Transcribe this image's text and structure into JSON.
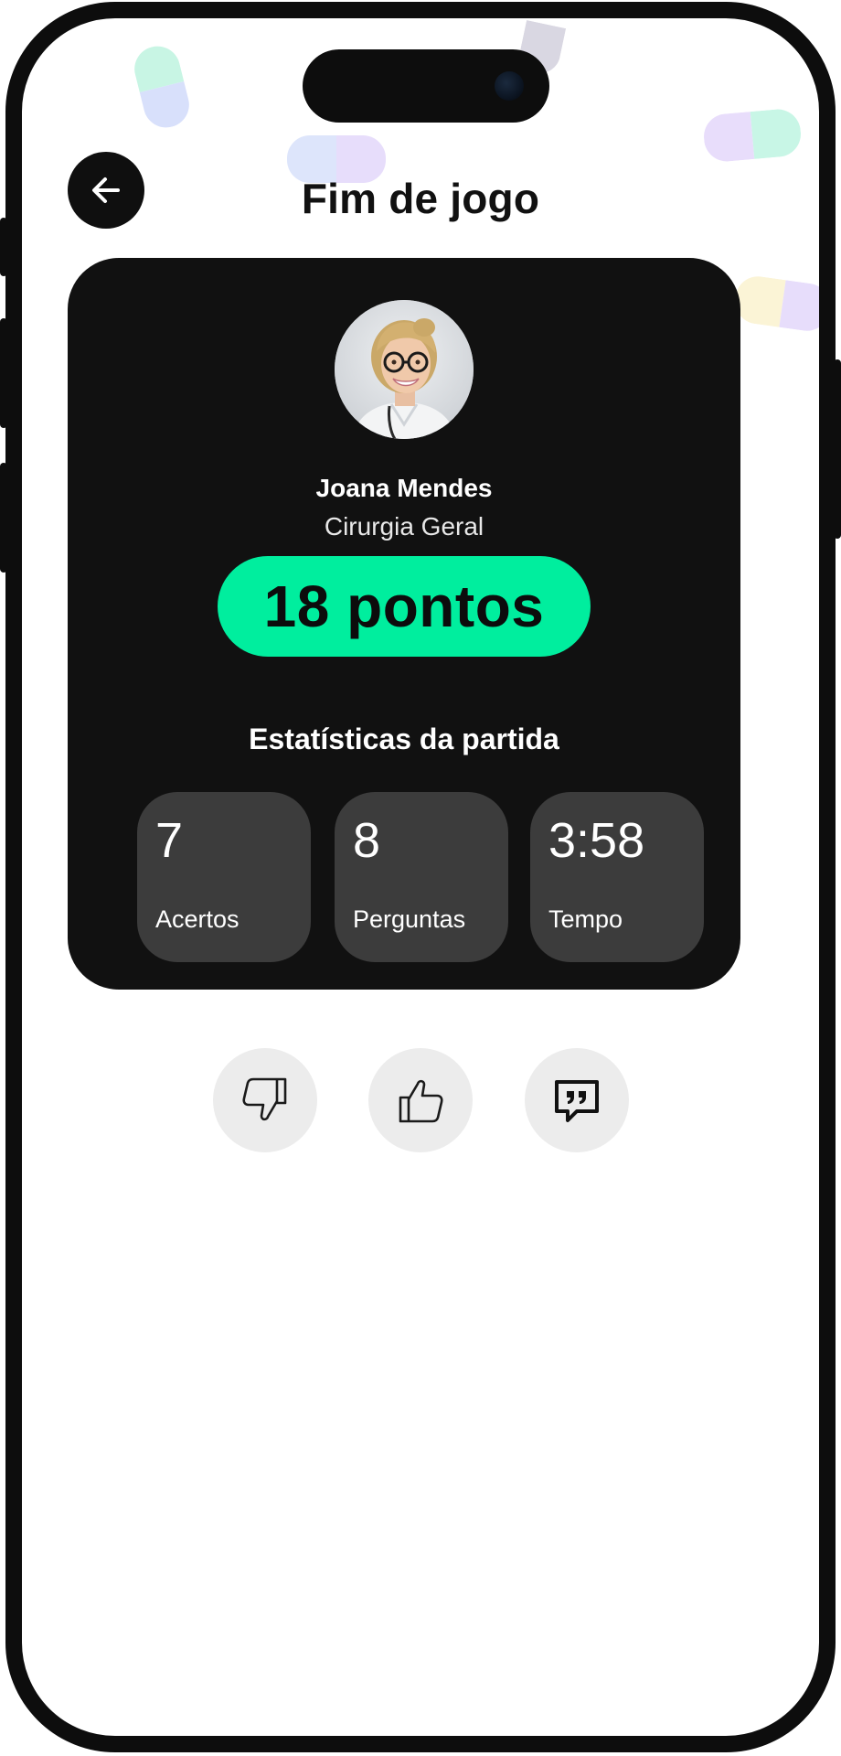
{
  "header": {
    "title": "Fim de jogo",
    "back_icon": "arrow-left-icon"
  },
  "player": {
    "name": "Joana Mendes",
    "specialty": "Cirurgia Geral"
  },
  "score": {
    "label": "18 pontos",
    "accent_color": "#00ee9e"
  },
  "stats": {
    "title": "Estatísticas da partida",
    "items": [
      {
        "value": "7",
        "label": "Acertos"
      },
      {
        "value": "8",
        "label": "Perguntas"
      },
      {
        "value": "3:58",
        "label": "Tempo"
      }
    ]
  },
  "feedback": {
    "buttons": [
      {
        "icon": "thumbs-down-icon"
      },
      {
        "icon": "thumbs-up-icon"
      },
      {
        "icon": "quote-comment-icon"
      }
    ]
  },
  "colors": {
    "card_background": "#111111",
    "tile_background": "#3c3c3c",
    "feedback_button_background": "#ececec"
  }
}
